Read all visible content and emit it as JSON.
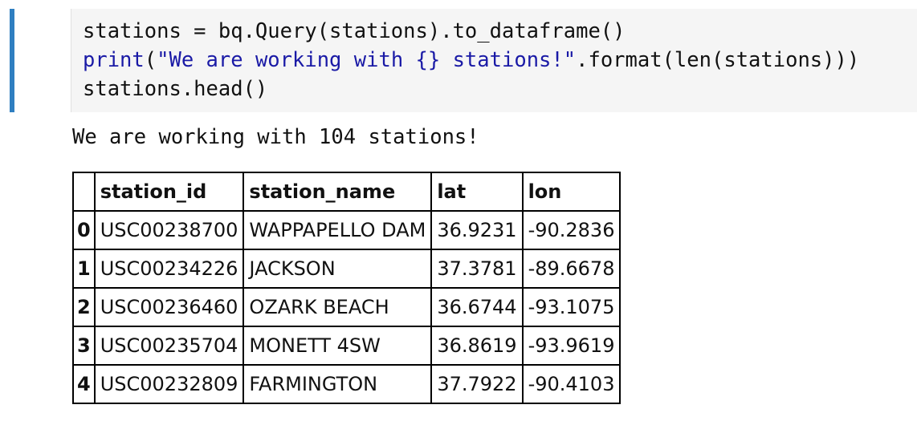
{
  "code_cell": {
    "line1": "stations = bq.Query(stations).to_dataframe()",
    "line2_func": "print",
    "line2_paren_open": "(",
    "line2_string": "\"We are working with {} stations!\"",
    "line2_rest": ".format(len(stations)))",
    "line3": "stations.head()"
  },
  "output": {
    "stdout": "We are working with 104 stations!",
    "table": {
      "columns": [
        "",
        "station_id",
        "station_name",
        "lat",
        "lon"
      ],
      "rows": [
        {
          "index": "0",
          "station_id": "USC00238700",
          "station_name": "WAPPAPELLO DAM",
          "lat": "36.9231",
          "lon": "-90.2836"
        },
        {
          "index": "1",
          "station_id": "USC00234226",
          "station_name": "JACKSON",
          "lat": "37.3781",
          "lon": "-89.6678"
        },
        {
          "index": "2",
          "station_id": "USC00236460",
          "station_name": "OZARK BEACH",
          "lat": "36.6744",
          "lon": "-93.1075"
        },
        {
          "index": "3",
          "station_id": "USC00235704",
          "station_name": "MONETT 4SW",
          "lat": "36.8619",
          "lon": "-93.9619"
        },
        {
          "index": "4",
          "station_id": "USC00232809",
          "station_name": "FARMINGTON",
          "lat": "37.7922",
          "lon": "-90.4103"
        }
      ]
    }
  },
  "colors": {
    "cell_selected_bar": "#2f7fc1",
    "code_background": "#f5f5f5"
  }
}
